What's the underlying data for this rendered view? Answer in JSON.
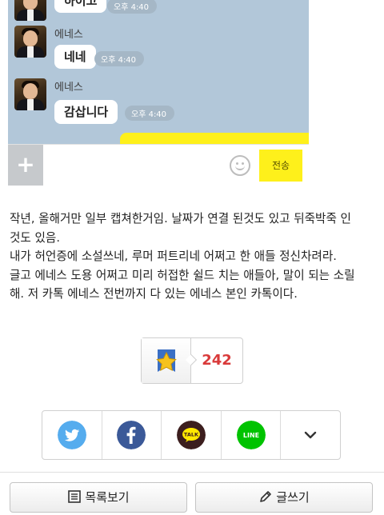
{
  "chat": {
    "sender": "에네스",
    "messages": [
      {
        "text": "하이고",
        "time": "오후 4:40"
      },
      {
        "text": "네네",
        "time": "오후 4:40"
      },
      {
        "text": "감삽니다",
        "time": "오후 4:40"
      }
    ],
    "input": {
      "plus": "+",
      "send_label": "전송"
    }
  },
  "article": {
    "lines": [
      "작년, 올해거만 일부 캡쳐한거임. 날짜가 연결 된것도 있고 뒤죽박죽 인",
      "것도 있음.",
      "내가 허언증에 소설쓰네, 루머 퍼트리네 어쩌고 한 애들 정신차려라.",
      "글고 에네스 도용 어쩌고 미리 허접한 쉴드 치는 애들아, 말이 되는 소릴",
      "해. 저 카톡 에네스 전번까지 다 있는 에네스 본인 카톡이다."
    ]
  },
  "recommend": {
    "count": "242",
    "icon": "star-icon"
  },
  "share": {
    "items": [
      {
        "name": "twitter",
        "icon": "twitter-icon",
        "color": "#55acee"
      },
      {
        "name": "facebook",
        "icon": "facebook-icon",
        "color": "#3b5998"
      },
      {
        "name": "kakaotalk",
        "icon": "kakaotalk-icon",
        "color": "#3c1e1e",
        "label": "TALK"
      },
      {
        "name": "line",
        "icon": "line-icon",
        "color": "#00c300",
        "label": "LINE"
      },
      {
        "name": "more",
        "icon": "chevron-down-icon"
      }
    ]
  },
  "buttons": {
    "list_label": "목록보기",
    "write_label": "글쓰기"
  }
}
